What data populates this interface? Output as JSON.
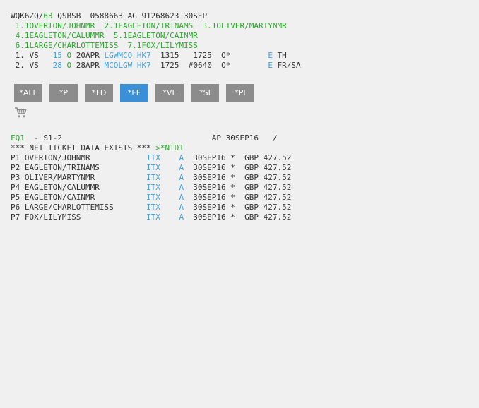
{
  "header": {
    "line": {
      "a": "WQK6ZQ/",
      "b": "63",
      "c": " QSBSB  0588663 AG 91268623 30SEP"
    }
  },
  "passengers": {
    "row1": " 1.1OVERTON/JOHNMR  2.1EAGLETON/TRINAMS  3.1OLIVER/MARTYNMR",
    "row2": " 4.1EAGLETON/CALUMMR  5.1EAGLETON/CAINMR",
    "row3": " 6.1LARGE/CHARLOTTEMISS  7.1FOX/LILYMISS"
  },
  "segments": [
    {
      "num": " 1. VS   ",
      "flight": "15",
      "class": " O ",
      "date": "20APR ",
      "route": "LGWMCO",
      "sp": " ",
      "status": "HK7",
      "times": "  1315   1725  O*        ",
      "e": "E",
      "days": " TH"
    },
    {
      "num": " 2. VS   ",
      "flight": "28",
      "class": " O ",
      "date": "28APR ",
      "route": "MCOLGW",
      "sp": " ",
      "status": "HK7",
      "times": "  1725  #0640  O*        ",
      "e": "E",
      "days": " FR/SA"
    }
  ],
  "tabs": [
    {
      "label": "*ALL",
      "active": false
    },
    {
      "label": "*P",
      "active": false
    },
    {
      "label": "*TD",
      "active": false
    },
    {
      "label": "*FF",
      "active": true
    },
    {
      "label": "*VL",
      "active": false
    },
    {
      "label": "*SI",
      "active": false
    },
    {
      "label": "*PI",
      "active": false
    }
  ],
  "cart_icon": "shopping-cart-icon",
  "fares": {
    "line1": {
      "code": "FQ1",
      "rest": "  - S1-2                                AP 30SEP16   /"
    },
    "line2": {
      "text": "*** NET TICKET DATA EXISTS *** ",
      "link": ">*NTD1"
    },
    "rows": [
      {
        "pax": "P1 OVERTON/JOHNMR            ",
        "type": "ITX",
        "sp": "    ",
        "a": "A",
        "rest": "  30SEP16 *  GBP 427.52"
      },
      {
        "pax": "P2 EAGLETON/TRINAMS          ",
        "type": "ITX",
        "sp": "    ",
        "a": "A",
        "rest": "  30SEP16 *  GBP 427.52"
      },
      {
        "pax": "P3 OLIVER/MARTYNMR           ",
        "type": "ITX",
        "sp": "    ",
        "a": "A",
        "rest": "  30SEP16 *  GBP 427.52"
      },
      {
        "pax": "P4 EAGLETON/CALUMMR          ",
        "type": "ITX",
        "sp": "    ",
        "a": "A",
        "rest": "  30SEP16 *  GBP 427.52"
      },
      {
        "pax": "P5 EAGLETON/CAINMR           ",
        "type": "ITX",
        "sp": "    ",
        "a": "A",
        "rest": "  30SEP16 *  GBP 427.52"
      },
      {
        "pax": "P6 LARGE/CHARLOTTEMISS       ",
        "type": "ITX",
        "sp": "    ",
        "a": "A",
        "rest": "  30SEP16 *  GBP 427.52"
      },
      {
        "pax": "P7 FOX/LILYMISS              ",
        "type": "ITX",
        "sp": "    ",
        "a": "A",
        "rest": "  30SEP16 *  GBP 427.52"
      }
    ]
  }
}
